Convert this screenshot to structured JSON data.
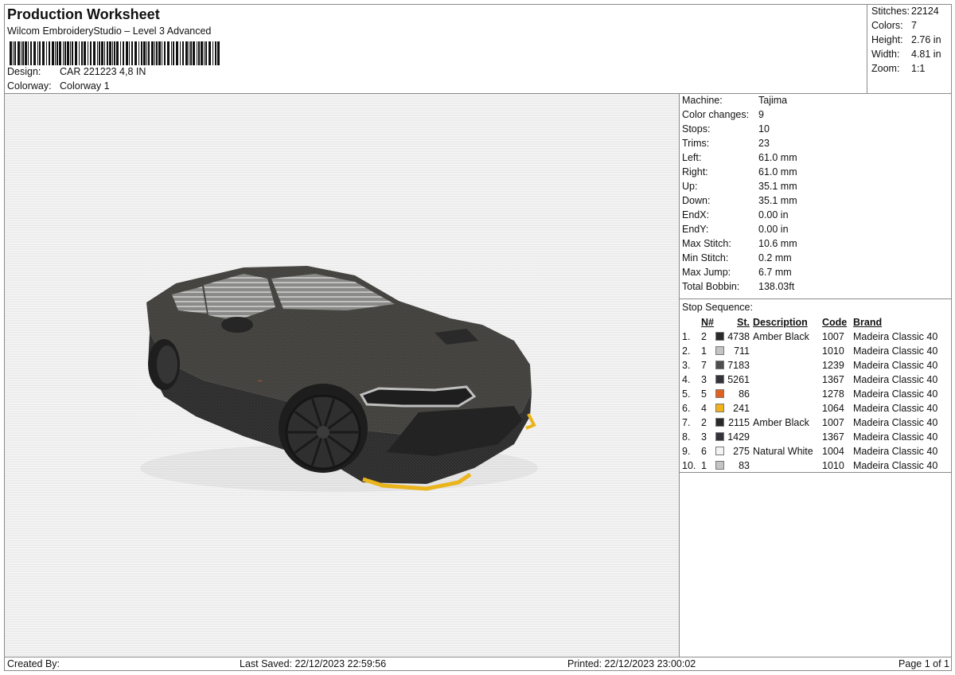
{
  "header": {
    "title": "Production Worksheet",
    "subtitle": "Wilcom EmbroideryStudio – Level 3 Advanced",
    "design_label": "Design:",
    "design_value": "CAR 221223 4,8 IN",
    "colorway_label": "Colorway:",
    "colorway_value": "Colorway 1"
  },
  "summary": [
    {
      "label": "Stitches:",
      "value": "22124"
    },
    {
      "label": "Colors:",
      "value": "7"
    },
    {
      "label": "Height:",
      "value": "2.76 in"
    },
    {
      "label": "Width:",
      "value": "4.81 in"
    },
    {
      "label": "Zoom:",
      "value": "1:1"
    }
  ],
  "machine": [
    {
      "label": "Machine:",
      "value": "Tajima"
    },
    {
      "label": "Color changes:",
      "value": "9"
    },
    {
      "label": "Stops:",
      "value": "10"
    },
    {
      "label": "Trims:",
      "value": "23"
    },
    {
      "label": "Left:",
      "value": "61.0 mm"
    },
    {
      "label": "Right:",
      "value": "61.0 mm"
    },
    {
      "label": "Up:",
      "value": "35.1 mm"
    },
    {
      "label": "Down:",
      "value": "35.1 mm"
    },
    {
      "label": "EndX:",
      "value": "0.00 in"
    },
    {
      "label": "EndY:",
      "value": "0.00 in"
    },
    {
      "label": "Max Stitch:",
      "value": "10.6 mm"
    },
    {
      "label": "Min Stitch:",
      "value": "0.2 mm"
    },
    {
      "label": "Max Jump:",
      "value": "6.7 mm"
    },
    {
      "label": "Total Bobbin:",
      "value": "138.03ft"
    }
  ],
  "stop_sequence": {
    "caption": "Stop Sequence:",
    "headers": {
      "n": "N#",
      "st": "St.",
      "description": "Description",
      "code": "Code",
      "brand": "Brand"
    },
    "rows": [
      {
        "idx": "1.",
        "n": "2",
        "color": "#2a2a2a",
        "st": "4738",
        "description": "Amber Black",
        "code": "1007",
        "brand": "Madeira Classic 40"
      },
      {
        "idx": "2.",
        "n": "1",
        "color": "#c4c4c4",
        "st": "711",
        "description": "",
        "code": "1010",
        "brand": "Madeira Classic 40"
      },
      {
        "idx": "3.",
        "n": "7",
        "color": "#4e4e4e",
        "st": "7183",
        "description": "",
        "code": "1239",
        "brand": "Madeira Classic 40"
      },
      {
        "idx": "4.",
        "n": "3",
        "color": "#33343a",
        "st": "5261",
        "description": "",
        "code": "1367",
        "brand": "Madeira Classic 40"
      },
      {
        "idx": "5.",
        "n": "5",
        "color": "#e0621e",
        "st": "86",
        "description": "",
        "code": "1278",
        "brand": "Madeira Classic 40"
      },
      {
        "idx": "6.",
        "n": "4",
        "color": "#f2b21c",
        "st": "241",
        "description": "",
        "code": "1064",
        "brand": "Madeira Classic 40"
      },
      {
        "idx": "7.",
        "n": "2",
        "color": "#2a2a2a",
        "st": "2115",
        "description": "Amber Black",
        "code": "1007",
        "brand": "Madeira Classic 40"
      },
      {
        "idx": "8.",
        "n": "3",
        "color": "#33343a",
        "st": "1429",
        "description": "",
        "code": "1367",
        "brand": "Madeira Classic 40"
      },
      {
        "idx": "9.",
        "n": "6",
        "color": "#f3f3f3",
        "st": "275",
        "description": "Natural White",
        "code": "1004",
        "brand": "Madeira Classic 40"
      },
      {
        "idx": "10.",
        "n": "1",
        "color": "#c4c4c4",
        "st": "83",
        "description": "",
        "code": "1010",
        "brand": "Madeira Classic 40"
      }
    ]
  },
  "footer": {
    "created_by": "Created By:",
    "last_saved": "Last Saved: 22/12/2023 22:59:56",
    "printed": "Printed: 22/12/2023 23:00:02",
    "page": "Page 1 of 1"
  },
  "colors": {
    "border": "#8a8a8a",
    "preview_bg": "#ececec",
    "car_body": "#3a3a38",
    "car_dark": "#262626",
    "accent_yellow": "#e9b41c",
    "accent_orange": "#e0621e"
  }
}
